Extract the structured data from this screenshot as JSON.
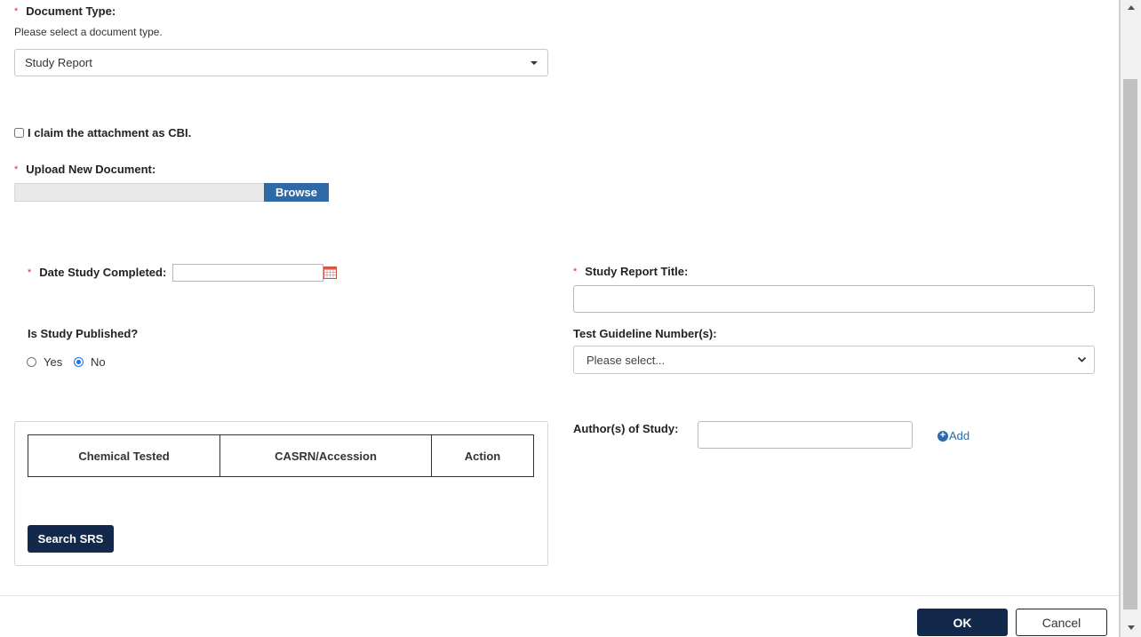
{
  "document_type": {
    "required_marker": "*",
    "label": "Document Type:",
    "help_text": "Please select a document type.",
    "selected_value": "Study Report"
  },
  "cbi": {
    "label": "I claim the attachment as CBI.",
    "checked": false
  },
  "upload": {
    "required_marker": "*",
    "label": "Upload New Document:",
    "browse_label": "Browse"
  },
  "date_completed": {
    "required_marker": "*",
    "label": "Date Study Completed:",
    "value": ""
  },
  "study_report_title": {
    "required_marker": "*",
    "label": "Study Report Title:",
    "value": ""
  },
  "published": {
    "label": "Is Study Published?",
    "options": [
      "Yes",
      "No"
    ],
    "selected": "No"
  },
  "test_guideline": {
    "label": "Test Guideline Number(s):",
    "placeholder": "Please select..."
  },
  "chemical_table": {
    "columns": [
      "Chemical Tested",
      "CASRN/Accession",
      "Action"
    ],
    "search_button": "Search SRS"
  },
  "authors": {
    "label": "Author(s) of Study:",
    "value": "",
    "add_label": "Add"
  },
  "footer": {
    "ok_label": "OK",
    "cancel_label": "Cancel"
  },
  "colors": {
    "required": "#d9263b",
    "primary_button": "#13294b",
    "browse_button": "#2d6aa7",
    "link": "#2d6aa7"
  }
}
